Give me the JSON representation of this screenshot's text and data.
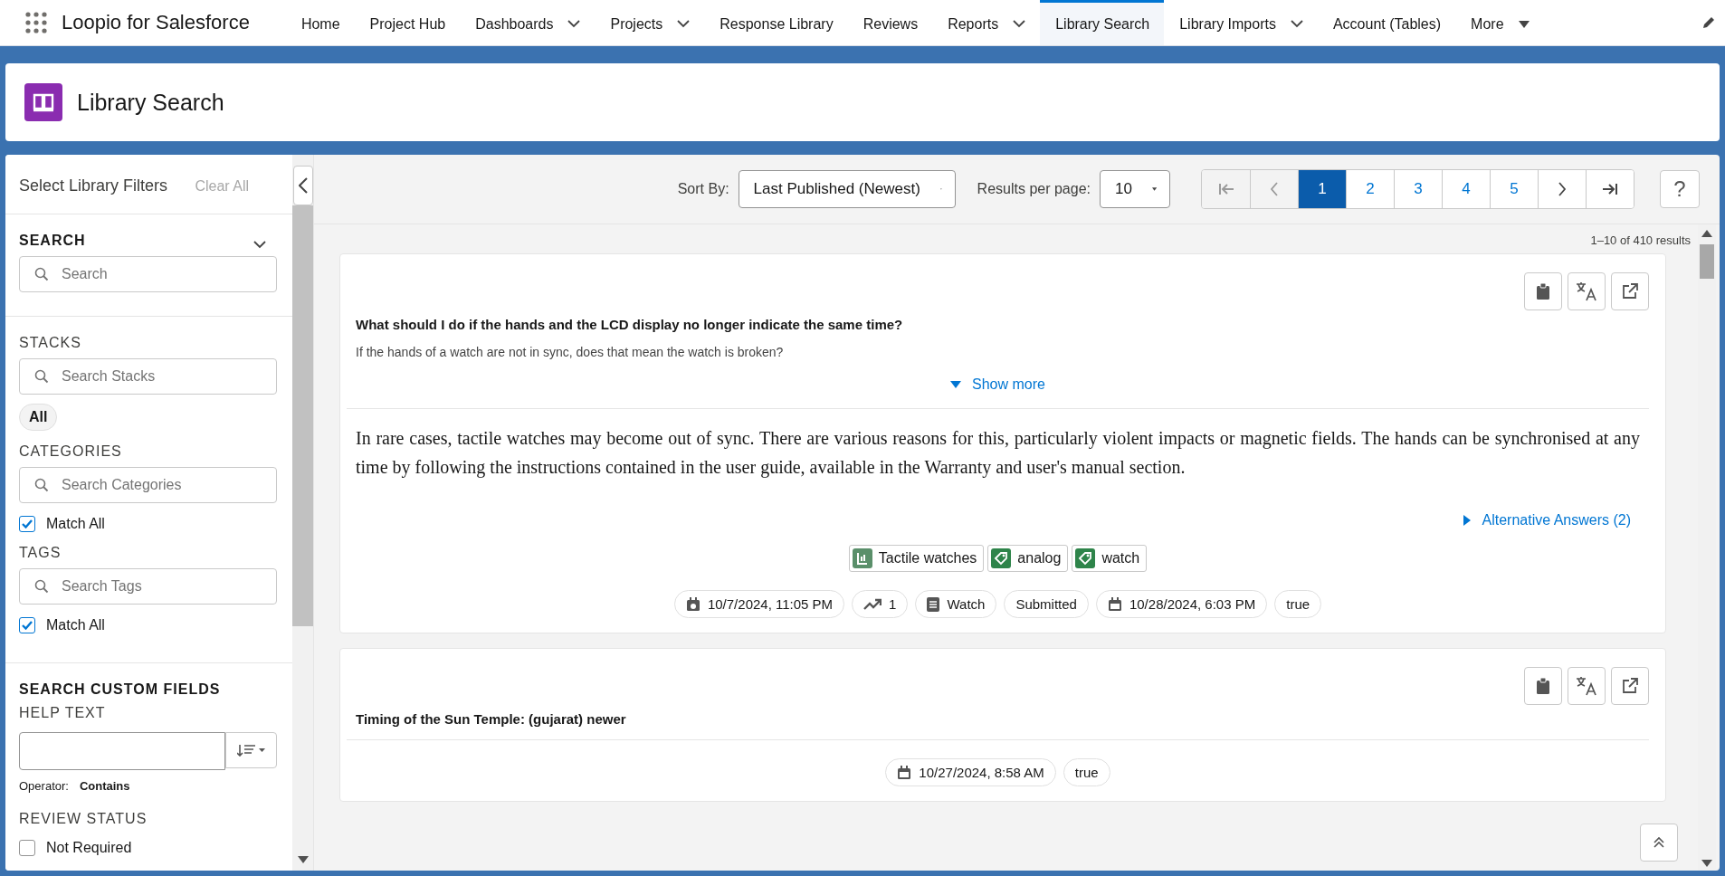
{
  "nav": {
    "app_name": "Loopio for Salesforce",
    "items": [
      {
        "label": "Home",
        "dropdown": false,
        "selected": false
      },
      {
        "label": "Project Hub",
        "dropdown": false,
        "selected": false
      },
      {
        "label": "Dashboards",
        "dropdown": true,
        "selected": false
      },
      {
        "label": "Projects",
        "dropdown": true,
        "selected": false
      },
      {
        "label": "Response Library",
        "dropdown": false,
        "selected": false
      },
      {
        "label": "Reviews",
        "dropdown": false,
        "selected": false
      },
      {
        "label": "Reports",
        "dropdown": true,
        "selected": false
      },
      {
        "label": "Library Search",
        "dropdown": false,
        "selected": true
      },
      {
        "label": "Library Imports",
        "dropdown": true,
        "selected": false
      },
      {
        "label": "Account (Tables)",
        "dropdown": false,
        "selected": false
      },
      {
        "label": "More",
        "dropdown": true,
        "selected": false
      }
    ]
  },
  "page_header": {
    "title": "Library Search"
  },
  "filters": {
    "title": "Select Library Filters",
    "clear_all": {
      "label": "Clear All",
      "disabled": true
    },
    "search": {
      "heading": "SEARCH",
      "placeholder": "Search"
    },
    "stacks": {
      "heading": "STACKS",
      "placeholder": "Search Stacks",
      "chips": [
        {
          "label": "All"
        }
      ]
    },
    "categories": {
      "heading": "CATEGORIES",
      "placeholder": "Search Categories",
      "match_all": {
        "label": "Match All",
        "checked": true
      }
    },
    "tags": {
      "heading": "TAGS",
      "placeholder": "Search Tags",
      "match_all": {
        "label": "Match All",
        "checked": true
      }
    },
    "custom_fields": {
      "heading": "SEARCH CUSTOM FIELDS",
      "help_text": {
        "label": "HELP TEXT",
        "operator_label": "Operator:",
        "operator": "Contains"
      }
    },
    "review_status": {
      "heading": "REVIEW STATUS",
      "options": [
        {
          "label": "Not Required",
          "checked": false
        }
      ]
    }
  },
  "toolbar": {
    "sort_label": "Sort By:",
    "sort_value": "Last Published (Newest)",
    "per_page_label": "Results per page:",
    "per_page_value": "10",
    "prev_disabled": true,
    "next_disabled": false,
    "pages": [
      {
        "label": "1",
        "selected": true
      },
      {
        "label": "2",
        "selected": false
      },
      {
        "label": "3",
        "selected": false
      },
      {
        "label": "4",
        "selected": false
      },
      {
        "label": "5",
        "selected": false
      }
    ],
    "help": "?"
  },
  "results_count": "1–10 of 410 results",
  "results": [
    {
      "question": "What should I do if the hands and the LCD display no longer indicate the same time?",
      "subtext": "If the hands of a watch are not in sync, does that mean the watch is broken?",
      "show_more": "Show more",
      "answer": "In rare cases, tactile watches may become out of sync. There are various reasons for this, particularly violent impacts or magnetic fields. The hands can be synchronised at any time by following the instructions contained in the user guide, available in the Warranty and user's manual section.",
      "alternatives": "Alternative Answers (2)",
      "tags": [
        {
          "label": "Tactile watches",
          "kind": "category"
        },
        {
          "label": "analog",
          "kind": "tag"
        },
        {
          "label": "watch",
          "kind": "tag"
        }
      ],
      "meta": [
        {
          "kind": "created",
          "text": "10/7/2024, 11:05 PM"
        },
        {
          "kind": "trend",
          "text": "1"
        },
        {
          "kind": "stack",
          "text": "Watch"
        },
        {
          "kind": "plain",
          "text": "Submitted"
        },
        {
          "kind": "updated",
          "text": "10/28/2024, 6:03 PM"
        },
        {
          "kind": "plain",
          "text": "true"
        }
      ]
    },
    {
      "question": "Timing of the Sun Temple: (gujarat) newer",
      "meta": [
        {
          "kind": "updated",
          "text": "10/27/2024, 8:58 AM"
        },
        {
          "kind": "plain",
          "text": "true"
        }
      ]
    }
  ]
}
